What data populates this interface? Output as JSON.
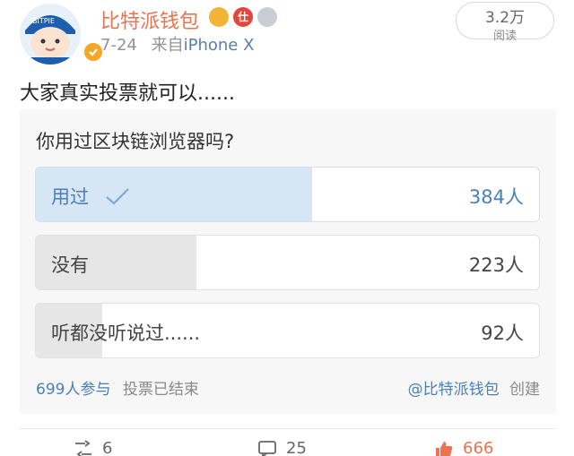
{
  "header": {
    "username": "比特派钱包",
    "date": "7-24",
    "source_prefix": "来自",
    "device": "iPhone X",
    "badge_b_text": "仕",
    "avatar_text": "BITPIE",
    "read_count": "3.2万",
    "read_label": "阅读"
  },
  "post": {
    "text": "大家真实投票就可以......"
  },
  "poll": {
    "question": "你用过区块链浏览器吗?",
    "options": [
      {
        "label": "用过",
        "count": "384人",
        "votes": 384,
        "selected": true
      },
      {
        "label": "没有",
        "count": "223人",
        "votes": 223,
        "selected": false
      },
      {
        "label": "听都没听说过......",
        "count": "92人",
        "votes": 92,
        "selected": false
      }
    ],
    "participants": "699人参与",
    "status": "投票已结束",
    "creator": "@比特派钱包",
    "created_label": "创建"
  },
  "actions": {
    "repost_count": "6",
    "comment_count": "25",
    "like_count": "666"
  },
  "colors": {
    "accent": "#eb7350",
    "link": "#4a7fb8",
    "selected_fill": "#d7e6f5",
    "bar_fill": "#e6e6e6"
  }
}
